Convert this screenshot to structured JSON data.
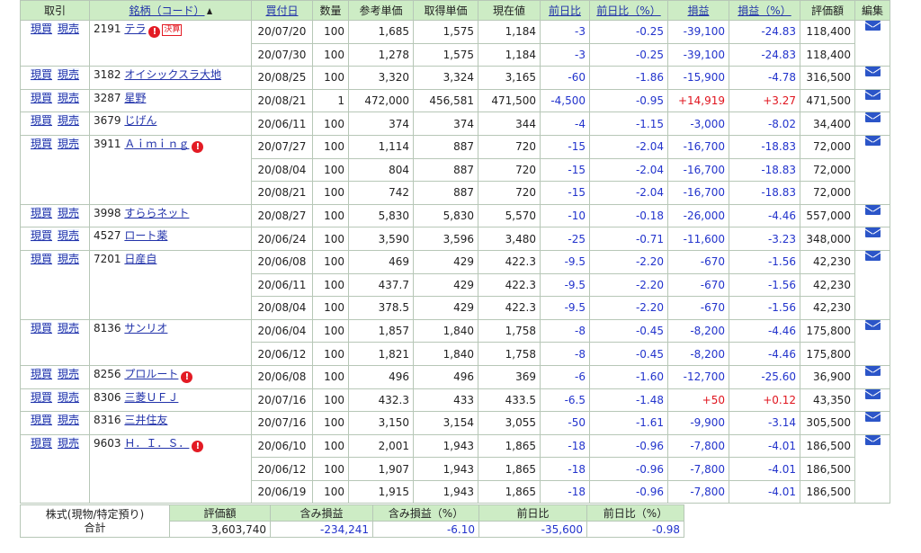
{
  "headers": {
    "trade": "取引",
    "name": "銘柄（コード）",
    "date": "買付日",
    "qty": "数量",
    "ref_price": "参考単価",
    "cost": "取得単価",
    "current": "現在値",
    "day_change": "前日比",
    "day_change_pct": "前日比（%）",
    "pl": "損益",
    "pl_pct": "損益（%）",
    "value": "評価額",
    "edit": "編集"
  },
  "buy_label": "現買",
  "sell_label": "現売",
  "kessan_label": "決算",
  "warn_mark": "!",
  "holdings": [
    {
      "code": "2191",
      "name": "テラ",
      "warn": true,
      "kessan": true,
      "lots": [
        {
          "date": "20/07/20",
          "qty": "100",
          "ref": "1,685",
          "cost": "1,575",
          "cur": "1,184",
          "chg": "-3",
          "chg_pct": "-0.25",
          "pl": "-39,100",
          "pl_pct": "-24.83",
          "value": "118,400"
        },
        {
          "date": "20/07/30",
          "qty": "100",
          "ref": "1,278",
          "cost": "1,575",
          "cur": "1,184",
          "chg": "-3",
          "chg_pct": "-0.25",
          "pl": "-39,100",
          "pl_pct": "-24.83",
          "value": "118,400"
        }
      ]
    },
    {
      "code": "3182",
      "name": "オイシックスラ大地",
      "warn": false,
      "kessan": false,
      "lots": [
        {
          "date": "20/08/25",
          "qty": "100",
          "ref": "3,320",
          "cost": "3,324",
          "cur": "3,165",
          "chg": "-60",
          "chg_pct": "-1.86",
          "pl": "-15,900",
          "pl_pct": "-4.78",
          "value": "316,500"
        }
      ]
    },
    {
      "code": "3287",
      "name": "星野",
      "warn": false,
      "kessan": false,
      "lots": [
        {
          "date": "20/08/21",
          "qty": "1",
          "ref": "472,000",
          "cost": "456,581",
          "cur": "471,500",
          "chg": "-4,500",
          "chg_pct": "-0.95",
          "pl": "+14,919",
          "pl_pct": "+3.27",
          "value": "471,500"
        }
      ]
    },
    {
      "code": "3679",
      "name": "じげん",
      "warn": false,
      "kessan": false,
      "lots": [
        {
          "date": "20/06/11",
          "qty": "100",
          "ref": "374",
          "cost": "374",
          "cur": "344",
          "chg": "-4",
          "chg_pct": "-1.15",
          "pl": "-3,000",
          "pl_pct": "-8.02",
          "value": "34,400"
        }
      ]
    },
    {
      "code": "3911",
      "name": "Ａｉｍｉｎｇ",
      "warn": true,
      "kessan": false,
      "lots": [
        {
          "date": "20/07/27",
          "qty": "100",
          "ref": "1,114",
          "cost": "887",
          "cur": "720",
          "chg": "-15",
          "chg_pct": "-2.04",
          "pl": "-16,700",
          "pl_pct": "-18.83",
          "value": "72,000"
        },
        {
          "date": "20/08/04",
          "qty": "100",
          "ref": "804",
          "cost": "887",
          "cur": "720",
          "chg": "-15",
          "chg_pct": "-2.04",
          "pl": "-16,700",
          "pl_pct": "-18.83",
          "value": "72,000"
        },
        {
          "date": "20/08/21",
          "qty": "100",
          "ref": "742",
          "cost": "887",
          "cur": "720",
          "chg": "-15",
          "chg_pct": "-2.04",
          "pl": "-16,700",
          "pl_pct": "-18.83",
          "value": "72,000"
        }
      ]
    },
    {
      "code": "3998",
      "name": "すららネット",
      "warn": false,
      "kessan": false,
      "lots": [
        {
          "date": "20/08/27",
          "qty": "100",
          "ref": "5,830",
          "cost": "5,830",
          "cur": "5,570",
          "chg": "-10",
          "chg_pct": "-0.18",
          "pl": "-26,000",
          "pl_pct": "-4.46",
          "value": "557,000"
        }
      ]
    },
    {
      "code": "4527",
      "name": "ロート薬",
      "warn": false,
      "kessan": false,
      "lots": [
        {
          "date": "20/06/24",
          "qty": "100",
          "ref": "3,590",
          "cost": "3,596",
          "cur": "3,480",
          "chg": "-25",
          "chg_pct": "-0.71",
          "pl": "-11,600",
          "pl_pct": "-3.23",
          "value": "348,000"
        }
      ]
    },
    {
      "code": "7201",
      "name": "日産自",
      "warn": false,
      "kessan": false,
      "lots": [
        {
          "date": "20/06/08",
          "qty": "100",
          "ref": "469",
          "cost": "429",
          "cur": "422.3",
          "chg": "-9.5",
          "chg_pct": "-2.20",
          "pl": "-670",
          "pl_pct": "-1.56",
          "value": "42,230"
        },
        {
          "date": "20/06/11",
          "qty": "100",
          "ref": "437.7",
          "cost": "429",
          "cur": "422.3",
          "chg": "-9.5",
          "chg_pct": "-2.20",
          "pl": "-670",
          "pl_pct": "-1.56",
          "value": "42,230"
        },
        {
          "date": "20/08/04",
          "qty": "100",
          "ref": "378.5",
          "cost": "429",
          "cur": "422.3",
          "chg": "-9.5",
          "chg_pct": "-2.20",
          "pl": "-670",
          "pl_pct": "-1.56",
          "value": "42,230"
        }
      ]
    },
    {
      "code": "8136",
      "name": "サンリオ",
      "warn": false,
      "kessan": false,
      "lots": [
        {
          "date": "20/06/04",
          "qty": "100",
          "ref": "1,857",
          "cost": "1,840",
          "cur": "1,758",
          "chg": "-8",
          "chg_pct": "-0.45",
          "pl": "-8,200",
          "pl_pct": "-4.46",
          "value": "175,800"
        },
        {
          "date": "20/06/12",
          "qty": "100",
          "ref": "1,821",
          "cost": "1,840",
          "cur": "1,758",
          "chg": "-8",
          "chg_pct": "-0.45",
          "pl": "-8,200",
          "pl_pct": "-4.46",
          "value": "175,800"
        }
      ]
    },
    {
      "code": "8256",
      "name": "プロルート",
      "warn": true,
      "kessan": false,
      "lots": [
        {
          "date": "20/06/08",
          "qty": "100",
          "ref": "496",
          "cost": "496",
          "cur": "369",
          "chg": "-6",
          "chg_pct": "-1.60",
          "pl": "-12,700",
          "pl_pct": "-25.60",
          "value": "36,900"
        }
      ]
    },
    {
      "code": "8306",
      "name": "三菱ＵＦＪ",
      "warn": false,
      "kessan": false,
      "lots": [
        {
          "date": "20/07/16",
          "qty": "100",
          "ref": "432.3",
          "cost": "433",
          "cur": "433.5",
          "chg": "-6.5",
          "chg_pct": "-1.48",
          "pl": "+50",
          "pl_pct": "+0.12",
          "value": "43,350"
        }
      ]
    },
    {
      "code": "8316",
      "name": "三井住友",
      "warn": false,
      "kessan": false,
      "lots": [
        {
          "date": "20/07/16",
          "qty": "100",
          "ref": "3,150",
          "cost": "3,154",
          "cur": "3,055",
          "chg": "-50",
          "chg_pct": "-1.61",
          "pl": "-9,900",
          "pl_pct": "-3.14",
          "value": "305,500"
        }
      ]
    },
    {
      "code": "9603",
      "name": "Ｈ．Ｉ．Ｓ．",
      "warn": true,
      "kessan": false,
      "lots": [
        {
          "date": "20/06/10",
          "qty": "100",
          "ref": "2,001",
          "cost": "1,943",
          "cur": "1,865",
          "chg": "-18",
          "chg_pct": "-0.96",
          "pl": "-7,800",
          "pl_pct": "-4.01",
          "value": "186,500"
        },
        {
          "date": "20/06/12",
          "qty": "100",
          "ref": "1,907",
          "cost": "1,943",
          "cur": "1,865",
          "chg": "-18",
          "chg_pct": "-0.96",
          "pl": "-7,800",
          "pl_pct": "-4.01",
          "value": "186,500"
        },
        {
          "date": "20/06/19",
          "qty": "100",
          "ref": "1,915",
          "cost": "1,943",
          "cur": "1,865",
          "chg": "-18",
          "chg_pct": "-0.96",
          "pl": "-7,800",
          "pl_pct": "-4.01",
          "value": "186,500"
        }
      ]
    }
  ],
  "summary": {
    "label_line1": "株式(現物/特定預り)",
    "label_line2": "合計",
    "headers": {
      "value": "評価額",
      "unrealized": "含み損益",
      "unrealized_pct": "含み損益（%）",
      "day_change": "前日比",
      "day_change_pct": "前日比（%）"
    },
    "values": {
      "value": "3,603,740",
      "unrealized": "-234,241",
      "unrealized_pct": "-6.10",
      "day_change": "-35,600",
      "day_change_pct": "-0.98"
    }
  },
  "colors": {
    "header_bg": "#cdecc5",
    "negative": "#2233cc",
    "positive": "#e0141e",
    "link": "#2233aa",
    "mail_icon": "#2b55c8"
  }
}
